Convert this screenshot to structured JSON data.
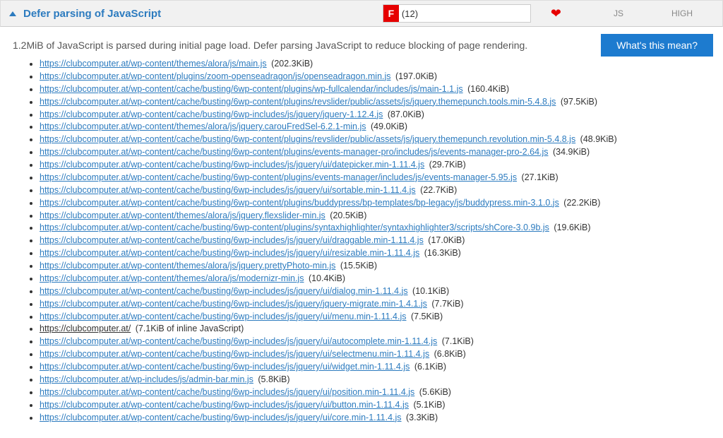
{
  "header": {
    "title": "Defer parsing of JavaScript",
    "grade_letter": "F",
    "grade_count": "(12)",
    "type": "JS",
    "priority": "HIGH"
  },
  "summary": "1.2MiB of JavaScript is parsed during initial page load. Defer parsing JavaScript to reduce blocking of page rendering.",
  "whats_this": "What's this mean?",
  "items": [
    {
      "url": "https://clubcomputer.at/wp-content/themes/alora/js/main.js",
      "size": "(202.3KiB)"
    },
    {
      "url": "https://clubcomputer.at/wp-content/plugins/zoom-openseadragon/js/openseadragon.min.js",
      "size": "(197.0KiB)"
    },
    {
      "url": "https://clubcomputer.at/wp-content/cache/busting/6wp-content/plugins/wp-fullcalendar/includes/js/main-1.1.js",
      "size": "(160.4KiB)"
    },
    {
      "url": "https://clubcomputer.at/wp-content/cache/busting/6wp-content/plugins/revslider/public/assets/js/jquery.themepunch.tools.min-5.4.8.js",
      "size": "(97.5KiB)"
    },
    {
      "url": "https://clubcomputer.at/wp-content/cache/busting/6wp-includes/js/jquery/jquery-1.12.4.js",
      "size": "(87.0KiB)"
    },
    {
      "url": "https://clubcomputer.at/wp-content/themes/alora/js/jquery.carouFredSel-6.2.1-min.js",
      "size": "(49.0KiB)"
    },
    {
      "url": "https://clubcomputer.at/wp-content/cache/busting/6wp-content/plugins/revslider/public/assets/js/jquery.themepunch.revolution.min-5.4.8.js",
      "size": "(48.9KiB)"
    },
    {
      "url": "https://clubcomputer.at/wp-content/cache/busting/6wp-content/plugins/events-manager-pro/includes/js/events-manager-pro-2.64.js",
      "size": "(34.9KiB)"
    },
    {
      "url": "https://clubcomputer.at/wp-content/cache/busting/6wp-includes/js/jquery/ui/datepicker.min-1.11.4.js",
      "size": "(29.7KiB)"
    },
    {
      "url": "https://clubcomputer.at/wp-content/cache/busting/6wp-content/plugins/events-manager/includes/js/events-manager-5.95.js",
      "size": "(27.1KiB)"
    },
    {
      "url": "https://clubcomputer.at/wp-content/cache/busting/6wp-includes/js/jquery/ui/sortable.min-1.11.4.js",
      "size": "(22.7KiB)"
    },
    {
      "url": "https://clubcomputer.at/wp-content/cache/busting/6wp-content/plugins/buddypress/bp-templates/bp-legacy/js/buddypress.min-3.1.0.js",
      "size": "(22.2KiB)"
    },
    {
      "url": "https://clubcomputer.at/wp-content/themes/alora/js/jquery.flexslider-min.js",
      "size": "(20.5KiB)"
    },
    {
      "url": "https://clubcomputer.at/wp-content/cache/busting/6wp-content/plugins/syntaxhighlighter/syntaxhighlighter3/scripts/shCore-3.0.9b.js",
      "size": "(19.6KiB)"
    },
    {
      "url": "https://clubcomputer.at/wp-content/cache/busting/6wp-includes/js/jquery/ui/draggable.min-1.11.4.js",
      "size": "(17.0KiB)"
    },
    {
      "url": "https://clubcomputer.at/wp-content/cache/busting/6wp-includes/js/jquery/ui/resizable.min-1.11.4.js",
      "size": "(16.3KiB)"
    },
    {
      "url": "https://clubcomputer.at/wp-content/themes/alora/js/jquery.prettyPhoto-min.js",
      "size": "(15.5KiB)"
    },
    {
      "url": "https://clubcomputer.at/wp-content/themes/alora/js/modernizr-min.js",
      "size": "(10.4KiB)"
    },
    {
      "url": "https://clubcomputer.at/wp-content/cache/busting/6wp-includes/js/jquery/ui/dialog.min-1.11.4.js",
      "size": "(10.1KiB)"
    },
    {
      "url": "https://clubcomputer.at/wp-content/cache/busting/6wp-includes/js/jquery/jquery-migrate.min-1.4.1.js",
      "size": "(7.7KiB)"
    },
    {
      "url": "https://clubcomputer.at/wp-content/cache/busting/6wp-includes/js/jquery/ui/menu.min-1.11.4.js",
      "size": "(7.5KiB)"
    },
    {
      "url": "https://clubcomputer.at/",
      "size": "(7.1KiB of inline JavaScript)",
      "nolink": true
    },
    {
      "url": "https://clubcomputer.at/wp-content/cache/busting/6wp-includes/js/jquery/ui/autocomplete.min-1.11.4.js",
      "size": "(7.1KiB)"
    },
    {
      "url": "https://clubcomputer.at/wp-content/cache/busting/6wp-includes/js/jquery/ui/selectmenu.min-1.11.4.js",
      "size": "(6.8KiB)"
    },
    {
      "url": "https://clubcomputer.at/wp-content/cache/busting/6wp-includes/js/jquery/ui/widget.min-1.11.4.js",
      "size": "(6.1KiB)"
    },
    {
      "url": "https://clubcomputer.at/wp-includes/js/admin-bar.min.js",
      "size": "(5.8KiB)"
    },
    {
      "url": "https://clubcomputer.at/wp-content/cache/busting/6wp-includes/js/jquery/ui/position.min-1.11.4.js",
      "size": "(5.6KiB)"
    },
    {
      "url": "https://clubcomputer.at/wp-content/cache/busting/6wp-includes/js/jquery/ui/button.min-1.11.4.js",
      "size": "(5.1KiB)"
    },
    {
      "url": "https://clubcomputer.at/wp-content/cache/busting/6wp-includes/js/jquery/ui/core.min-1.11.4.js",
      "size": "(3.3KiB)"
    }
  ]
}
